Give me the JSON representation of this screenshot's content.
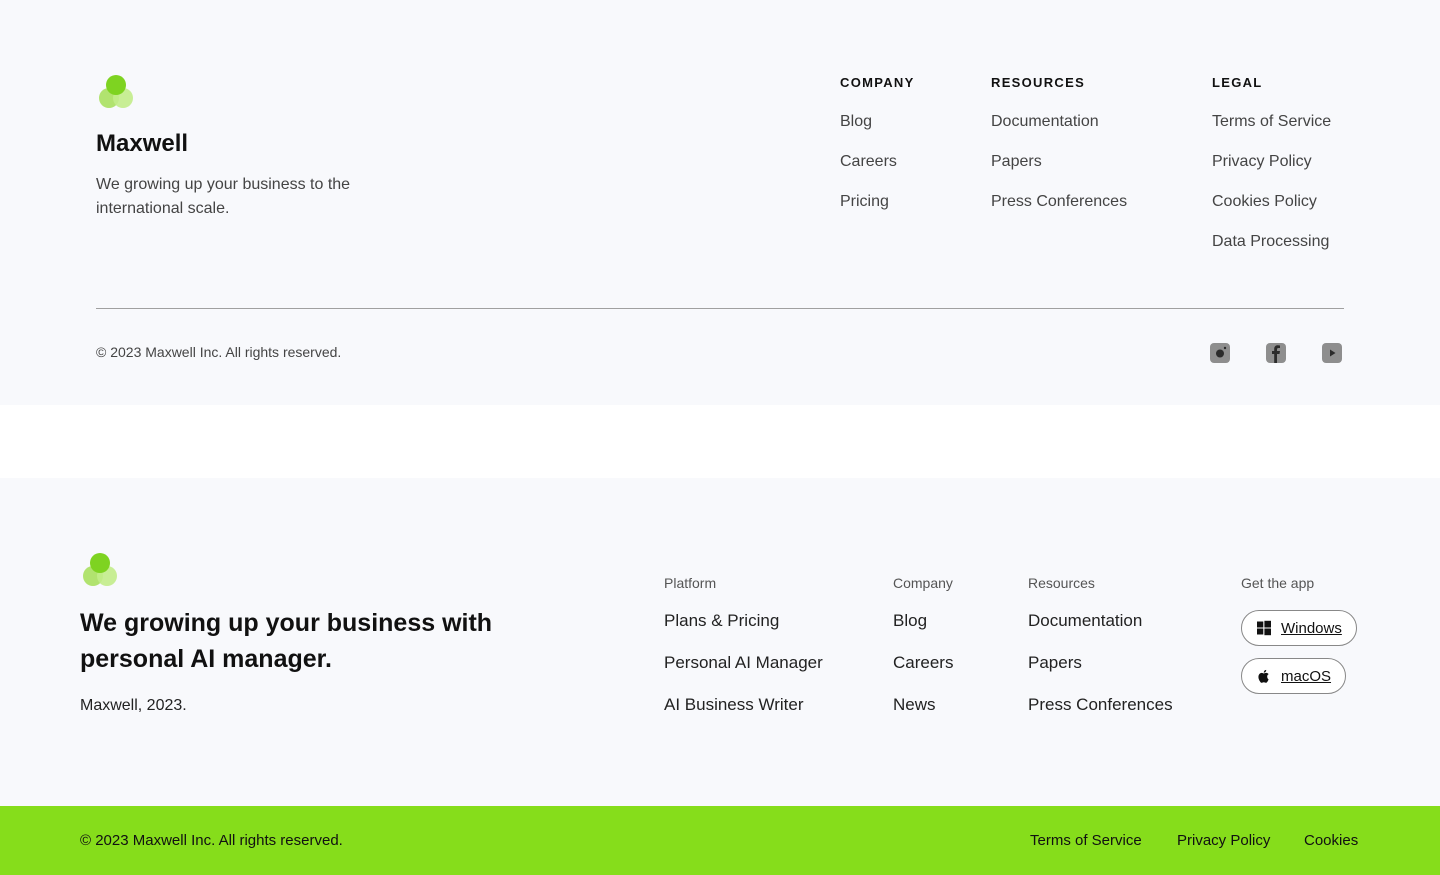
{
  "footer1": {
    "brand": "Maxwell",
    "tagline": "We growing up your business to the international scale.",
    "columns": [
      {
        "heading": "COMPANY",
        "links": [
          "Blog",
          "Careers",
          "Pricing"
        ]
      },
      {
        "heading": "RESOURCES",
        "links": [
          "Documentation",
          "Papers",
          "Press Conferences"
        ]
      },
      {
        "heading": "LEGAL",
        "links": [
          "Terms of Service",
          "Privacy Policy",
          "Cookies Policy",
          "Data Processing"
        ]
      }
    ],
    "copyright": "© 2023 Maxwell Inc. All rights reserved.",
    "social": [
      "instagram-icon",
      "facebook-icon",
      "youtube-icon"
    ]
  },
  "footer2": {
    "headline": "We growing up your business with personal AI manager.",
    "year": "Maxwell, 2023.",
    "columns": [
      {
        "heading": "Platform",
        "links": [
          "Plans & Pricing",
          "Personal AI Manager",
          "AI Business Writer"
        ]
      },
      {
        "heading": "Company",
        "links": [
          "Blog",
          "Careers",
          "News"
        ]
      },
      {
        "heading": "Resources",
        "links": [
          "Documentation",
          "Papers",
          "Press Conferences"
        ]
      }
    ],
    "get_app": {
      "heading": "Get the app",
      "buttons": [
        {
          "label": "Windows",
          "icon": "windows-icon"
        },
        {
          "label": "macOS",
          "icon": "apple-icon"
        }
      ]
    }
  },
  "bottom_bar": {
    "copyright": "© 2023 Maxwell Inc. All rights reserved.",
    "links": [
      "Terms of Service",
      "Privacy Policy",
      "Cookies"
    ]
  },
  "colors": {
    "accent": "#86dd1b",
    "logo_primary": "#7ed321",
    "background": "#f8f9fc"
  }
}
